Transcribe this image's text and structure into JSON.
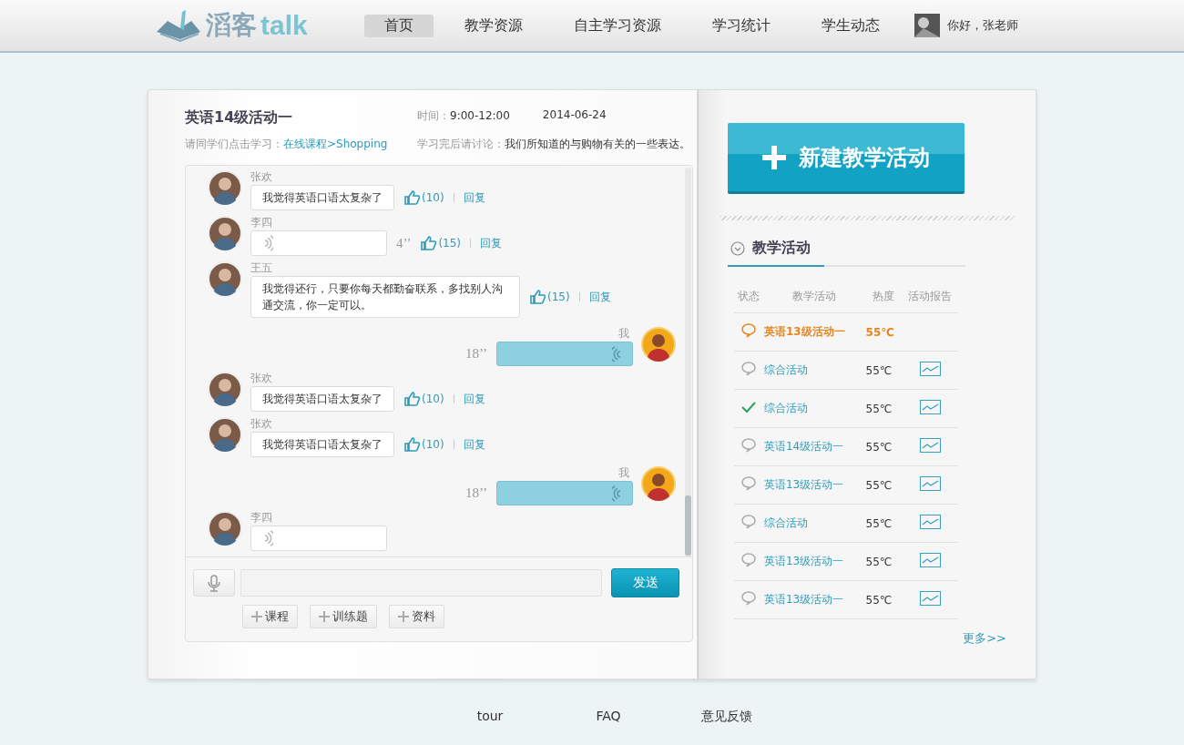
{
  "header": {
    "logo_text": "滔客",
    "logo_suffix": "talk",
    "nav": [
      {
        "label": "首页",
        "selected": true
      },
      {
        "label": "教学资源",
        "selected": false
      },
      {
        "label": "自主学习资源",
        "selected": false
      },
      {
        "label": "学习统计",
        "selected": false
      },
      {
        "label": "学生动态",
        "selected": false
      }
    ],
    "greeting": "你好，张老师"
  },
  "activity": {
    "title": "英语14级活动一",
    "prompt_label": "请同学们点击学习：",
    "prompt_link": "在线课程>Shopping",
    "time_label": "时间：",
    "time": "9:00-12:00",
    "date": "2014-06-24",
    "discuss_label": "学习完后请讨论：",
    "discuss_text": "我们所知道的与购物有关的一些表达。"
  },
  "messages": [
    {
      "kind": "text",
      "name": "张欢",
      "text": "我觉得英语口语太复杂了",
      "likes": "(10)",
      "reply": "回复"
    },
    {
      "kind": "voice",
      "name": "李四",
      "duration": "4’’",
      "likes": "(15)",
      "reply": "回复"
    },
    {
      "kind": "text",
      "name": "王五",
      "text": "我觉得还行，只要你每天都勤奋联系，多找别人沟通交流，你一定可以。",
      "likes": "(15)",
      "reply": "回复"
    },
    {
      "kind": "mine",
      "name": "我",
      "duration": "18’’"
    },
    {
      "kind": "text",
      "name": "张欢",
      "text": "我觉得英语口语太复杂了",
      "likes": "(10)",
      "reply": "回复"
    },
    {
      "kind": "text",
      "name": "张欢",
      "text": "我觉得英语口语太复杂了",
      "likes": "(10)",
      "reply": "回复"
    },
    {
      "kind": "mine",
      "name": "我",
      "duration": "18’’"
    },
    {
      "kind": "voice",
      "name": "李四"
    }
  ],
  "composer": {
    "send": "发送",
    "attachments": [
      "课程",
      "训练题",
      "资料"
    ]
  },
  "panel": {
    "new_button": "新建教学活动",
    "section_title": "教学活动",
    "columns": [
      "状态",
      "教学活动",
      "热度",
      "活动报告"
    ],
    "rows": [
      {
        "kind": "comment",
        "name": "英语13级活动一",
        "heat": "55℃",
        "report": false,
        "selected": true
      },
      {
        "kind": "comment",
        "name": "综合活动",
        "heat": "55℃",
        "report": true,
        "selected": false
      },
      {
        "kind": "done",
        "name": "综合活动",
        "heat": "55℃",
        "report": true,
        "selected": false
      },
      {
        "kind": "comment",
        "name": "英语14级活动一",
        "heat": "55℃",
        "report": true,
        "selected": false
      },
      {
        "kind": "comment",
        "name": "英语13级活动一",
        "heat": "55℃",
        "report": true,
        "selected": false
      },
      {
        "kind": "comment",
        "name": "综合活动",
        "heat": "55℃",
        "report": true,
        "selected": false
      },
      {
        "kind": "comment",
        "name": "英语13级活动一",
        "heat": "55℃",
        "report": true,
        "selected": false
      },
      {
        "kind": "comment",
        "name": "英语13级活动一",
        "heat": "55℃",
        "report": true,
        "selected": false
      }
    ],
    "more": "更多>>"
  },
  "footer": {
    "links": [
      "tour",
      "FAQ",
      "意见反馈"
    ]
  }
}
